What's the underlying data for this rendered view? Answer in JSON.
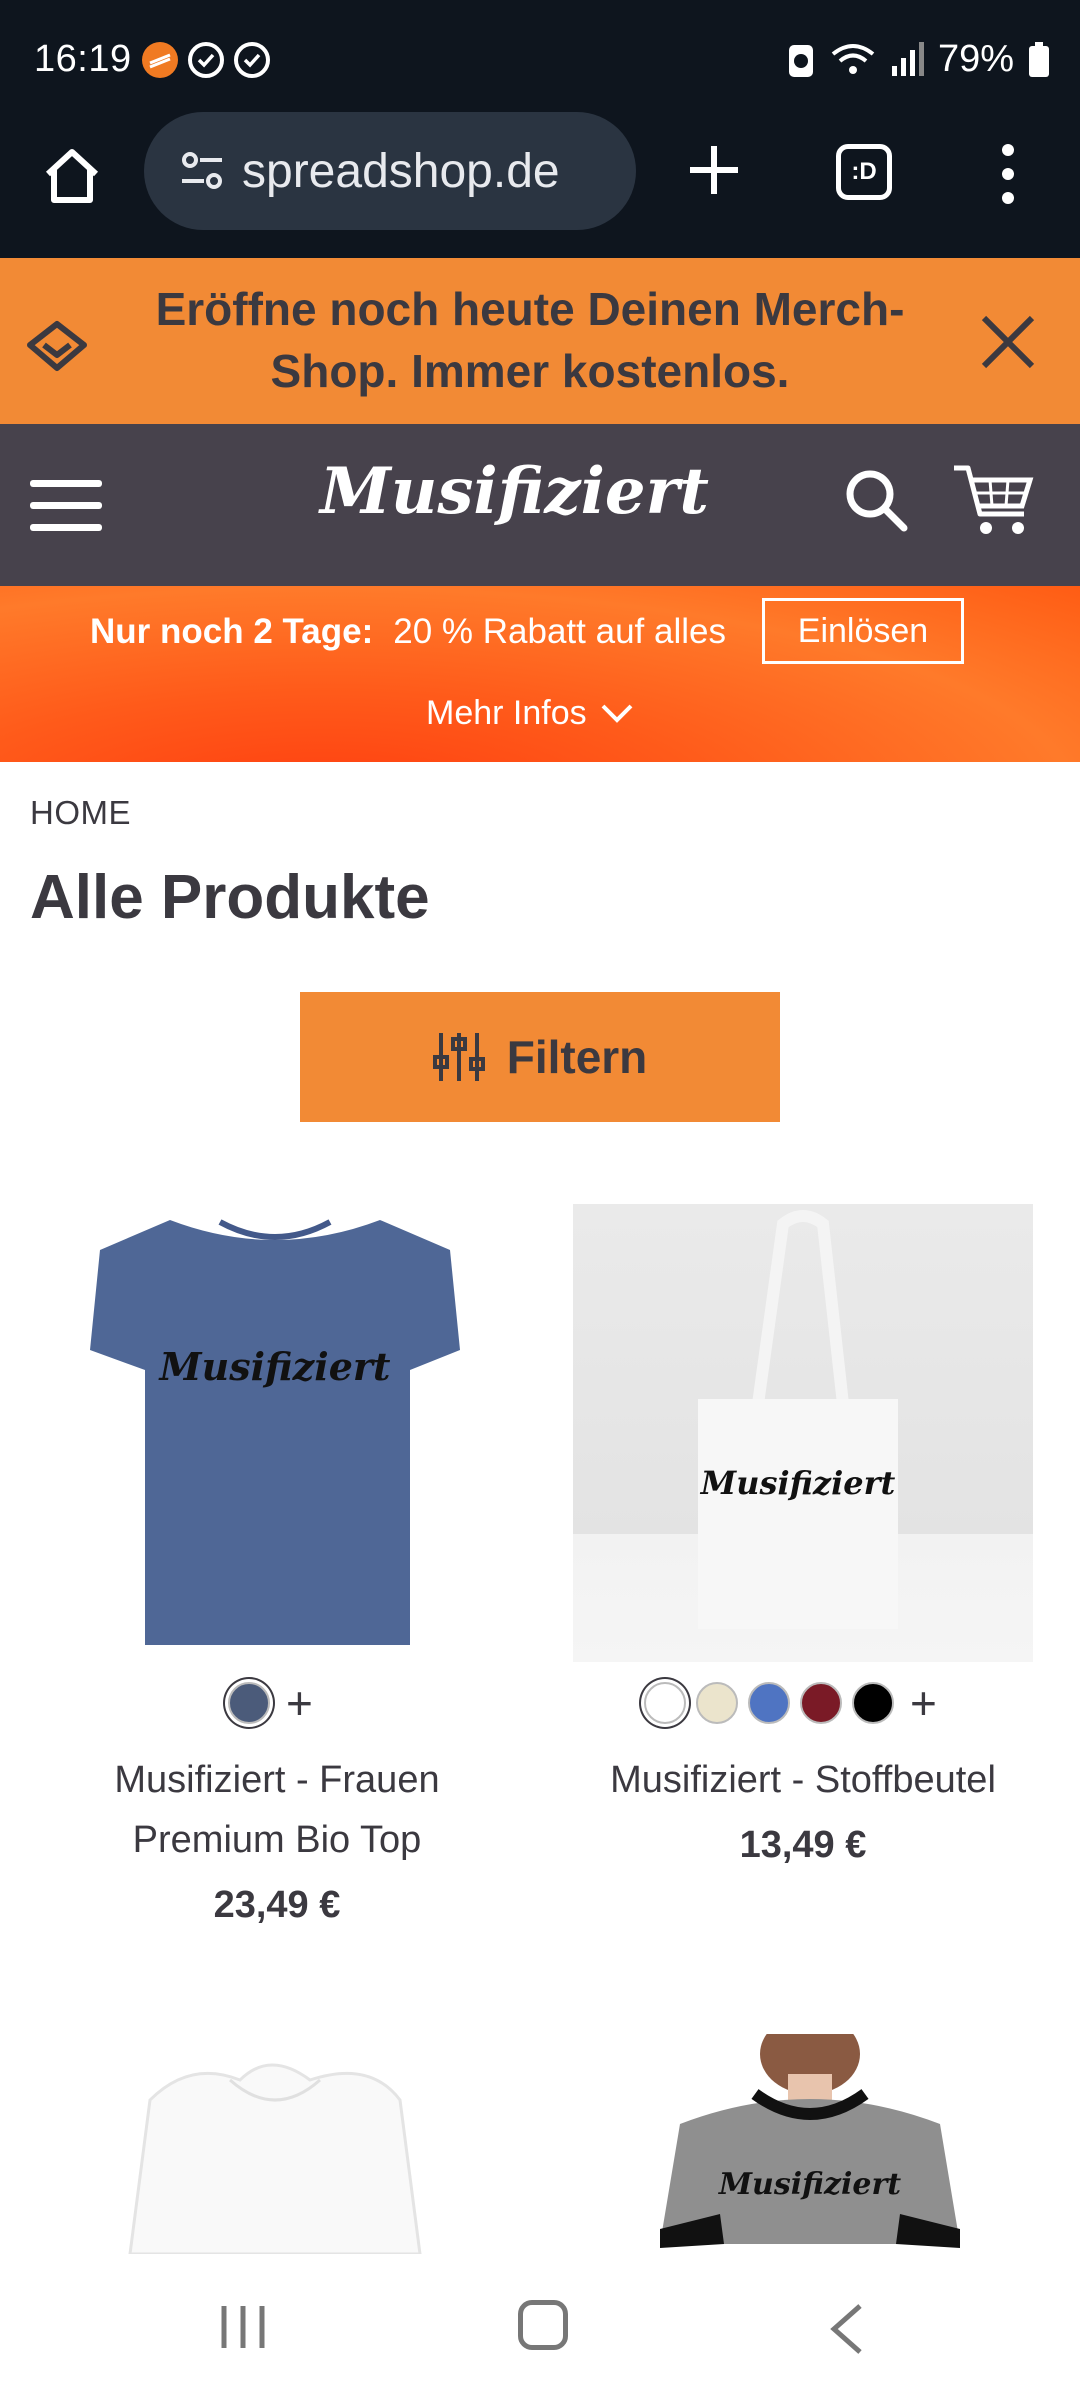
{
  "status_bar": {
    "time": "16:19",
    "battery": "79%"
  },
  "browser": {
    "url": "spreadshop.de",
    "tabs_label": ":D"
  },
  "promo": {
    "text": "Eröffne noch heute Deinen Merch-Shop. Immer kostenlos."
  },
  "header": {
    "logo_text": "Musifiziert"
  },
  "sale": {
    "strong": "Nur noch 2 Tage:",
    "text": "20 % Rabatt auf alles",
    "button": "Einlösen",
    "more": "Mehr Infos"
  },
  "breadcrumb": "HOME",
  "title": "Alle Produkte",
  "filter_label": "Filtern",
  "products": [
    {
      "name": "Musifiziert - Frauen Premium Bio Top",
      "price": "23,49 €",
      "print": "Musifiziert",
      "swatches": [
        "#4b5b7a"
      ]
    },
    {
      "name": "Musifiziert - Stoffbeutel",
      "price": "13,49 €",
      "print": "Musifiziert",
      "swatches": [
        "#ffffff",
        "#ebe4cc",
        "#4f74c2",
        "#7a1a26",
        "#000000"
      ]
    },
    {
      "name": "",
      "price": "",
      "print": "",
      "swatches": []
    },
    {
      "name": "",
      "price": "",
      "print": "Musifiziert",
      "swatches": []
    }
  ],
  "colors": {
    "accent": "#f28a35",
    "header": "#47424c",
    "sale": "#ff5a1a",
    "text": "#3b3940"
  }
}
